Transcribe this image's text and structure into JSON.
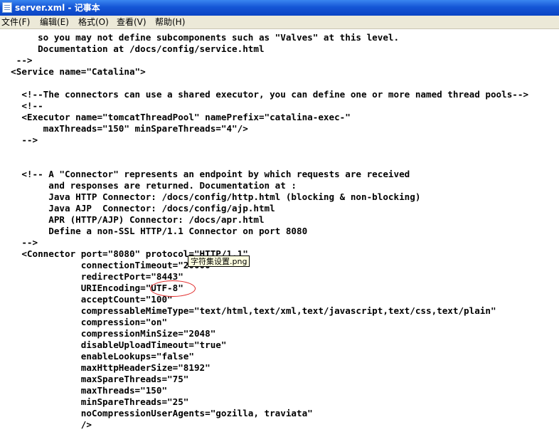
{
  "window": {
    "title": "server.xml - 记事本"
  },
  "menu": [
    {
      "label": "文件(F)"
    },
    {
      "label": "编辑(E)"
    },
    {
      "label": "格式(O)"
    },
    {
      "label": "查看(V)"
    },
    {
      "label": "帮助(H)"
    }
  ],
  "editor": {
    "lines": [
      "       so you may not define subcomponents such as \"Valves\" at this level.",
      "       Documentation at /docs/config/service.html",
      "   -->",
      "  <Service name=\"Catalina\">",
      "",
      "    <!--The connectors can use a shared executor, you can define one or more named thread pools-->",
      "    <!--",
      "    <Executor name=\"tomcatThreadPool\" namePrefix=\"catalina-exec-\"",
      "        maxThreads=\"150\" minSpareThreads=\"4\"/>",
      "    -->",
      "",
      "",
      "    <!-- A \"Connector\" represents an endpoint by which requests are received",
      "         and responses are returned. Documentation at :",
      "         Java HTTP Connector: /docs/config/http.html (blocking & non-blocking)",
      "         Java AJP  Connector: /docs/config/ajp.html",
      "         APR (HTTP/AJP) Connector: /docs/apr.html",
      "         Define a non-SSL HTTP/1.1 Connector on port 8080",
      "    -->",
      "    <Connector port=\"8080\" protocol=\"HTTP/1.1\"",
      "               connectionTimeout=\"20000\"",
      "               redirectPort=\"8443\"",
      "               URIEncoding=\"UTF-8\"",
      "               acceptCount=\"100\"",
      "               compressableMimeType=\"text/html,text/xml,text/javascript,text/css,text/plain\"",
      "               compression=\"on\"",
      "               compressionMinSize=\"2048\"",
      "               disableUploadTimeout=\"true\"",
      "               enableLookups=\"false\"",
      "               maxHttpHeaderSize=\"8192\"",
      "               maxSpareThreads=\"75\"",
      "               maxThreads=\"150\"",
      "               minSpareThreads=\"25\"",
      "               noCompressionUserAgents=\"gozilla, traviata\"",
      "               />"
    ]
  },
  "tooltip": {
    "text": "字符集设置.png"
  },
  "colors": {
    "titlebar": "#0a44c4",
    "menubar": "#ece9d8",
    "highlight": "#e02424",
    "tooltip_bg": "#ffffe1"
  }
}
